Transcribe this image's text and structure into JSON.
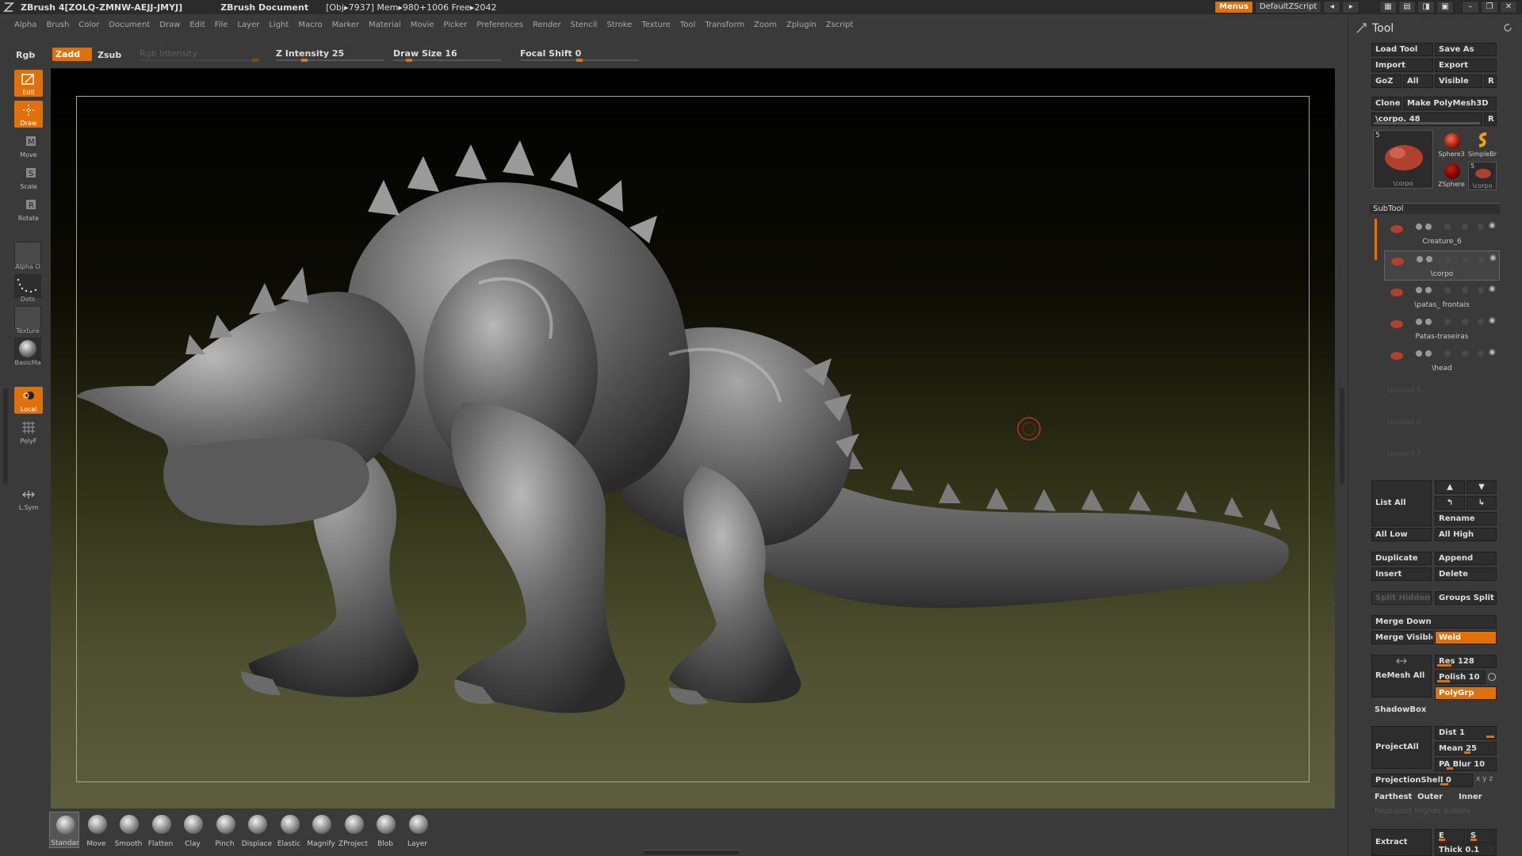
{
  "titlebar": {
    "app": "ZBrush 4[ZOLQ-ZMNW-AEJJ-JMYJ]",
    "document": "ZBrush Document",
    "info": "[Obj▸7937]  Mem▸980+1006  Free▸2042",
    "menus_button": "Menus",
    "script_button": "DefaultZScript"
  },
  "menubar": {
    "items": [
      "Alpha",
      "Brush",
      "Color",
      "Document",
      "Draw",
      "Edit",
      "File",
      "Layer",
      "Light",
      "Macro",
      "Marker",
      "Material",
      "Movie",
      "Picker",
      "Preferences",
      "Render",
      "Stencil",
      "Stroke",
      "Texture",
      "Tool",
      "Transform",
      "Zoom",
      "Zplugin",
      "Zscript"
    ]
  },
  "toolbar": {
    "rgb": "Rgb",
    "zadd": "Zadd",
    "zsub": "Zsub",
    "rgb_intensity": "Rgb Intensity",
    "z_intensity": "Z Intensity 25",
    "z_intensity_value": 25,
    "draw_size": "Draw Size 16",
    "draw_size_value": 16,
    "focal_shift": "Focal Shift 0",
    "focal_shift_value": 0
  },
  "leftshelf": {
    "edit": "Edit",
    "draw": "Draw",
    "move": "Move",
    "scale": "Scale",
    "rotate": "Rotate",
    "alpha": "Alpha",
    "alpha_state": "O",
    "dots": "Dots",
    "texture": "Texture",
    "material": "BasicMa",
    "local": "Local",
    "polyf": "PolyF",
    "lsym": "L.Sym"
  },
  "brushes": [
    {
      "label": "Standar",
      "selected": true
    },
    {
      "label": "Move",
      "selected": false
    },
    {
      "label": "Smooth",
      "selected": false
    },
    {
      "label": "Flatten",
      "selected": false
    },
    {
      "label": "Clay",
      "selected": false
    },
    {
      "label": "Pinch",
      "selected": false
    },
    {
      "label": "Displace",
      "selected": false
    },
    {
      "label": "Elastic",
      "selected": false
    },
    {
      "label": "Magnify",
      "selected": false
    },
    {
      "label": "ZProject",
      "selected": false
    },
    {
      "label": "Blob",
      "selected": false
    },
    {
      "label": "Layer",
      "selected": false
    }
  ],
  "tool": {
    "title": "Tool",
    "load_tool": "Load Tool",
    "save_as": "Save As",
    "import": "Import",
    "export": "Export",
    "goz": "GoZ",
    "all": "All",
    "visible": "Visible",
    "r": "R",
    "clone": "Clone",
    "make_polymesh": "Make PolyMesh3D",
    "current_tool": "\\corpo. 48",
    "thumb_count": "5",
    "thumb_label": "\\corpo",
    "sphere3": "Sphere3",
    "simplebr": "SimpleBr",
    "zsphere": "ZSphere",
    "corpo_small": "\\corpo",
    "corpo_small_count": "5"
  },
  "subtool": {
    "title": "SubTool",
    "items": [
      {
        "name": "Creature_6",
        "selected": false
      },
      {
        "name": "\\corpo",
        "selected": true
      },
      {
        "name": "\\patas_ frontais",
        "selected": false
      },
      {
        "name": "Patas-traseiras",
        "selected": false
      },
      {
        "name": "\\head",
        "selected": false
      }
    ],
    "unused": [
      "Unused 5",
      "Unused 6",
      "Unused 7"
    ],
    "list_all": "List All",
    "rename": "Rename",
    "all_low": "All Low",
    "all_high": "All High",
    "duplicate": "Duplicate",
    "append": "Append",
    "insert": "Insert",
    "delete": "Delete",
    "split_hidden": "Split Hidden",
    "groups_split": "Groups Split",
    "merge_down": "Merge Down",
    "merge_visible": "Merge Visible",
    "weld": "Weld",
    "remesh_all": "ReMesh  All",
    "res": "Res 128",
    "polish": "Polish 10",
    "polygrp": "PolyGrp",
    "shadowbox": "ShadowBox",
    "project_all": "ProjectAll",
    "dist": "Dist 1",
    "mean": "Mean 25",
    "pa_blur": "PA Blur 10",
    "projection_shell": "ProjectionShell 0",
    "farthest": "Farthest",
    "outer": "Outer",
    "inner": "Inner",
    "reproject": "Reproject Higher Subdiv",
    "extract": "Extract",
    "e_smt": "E Smt",
    "s_smt": "S Smt",
    "thick": "Thick 0.1"
  },
  "colors": {
    "accent": "#e0700a",
    "panel": "#3a3a3a",
    "button": "#2d2d2d"
  }
}
